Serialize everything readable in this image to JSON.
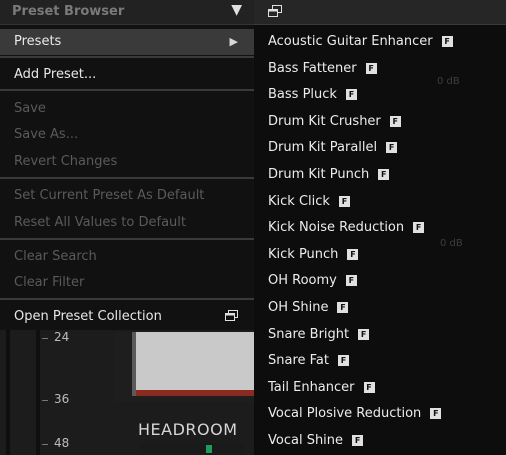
{
  "header": {
    "title": "Preset Browser",
    "dropdown_arrow": "▼"
  },
  "menu": {
    "presets": "Presets",
    "presets_arrow": "▶",
    "add_preset": "Add Preset...",
    "save": "Save",
    "save_as": "Save As...",
    "revert": "Revert Changes",
    "set_default": "Set Current Preset As Default",
    "reset_default": "Reset All Values to Default",
    "clear_search": "Clear Search",
    "clear_filter": "Clear Filter",
    "open_collection": "Open Preset Collection"
  },
  "presets": [
    {
      "label": "Acoustic Guitar Enhancer",
      "badge": "F"
    },
    {
      "label": "Bass Fattener",
      "badge": "F"
    },
    {
      "label": "Bass Pluck",
      "badge": "F"
    },
    {
      "label": "Drum Kit Crusher",
      "badge": "F"
    },
    {
      "label": "Drum Kit Parallel",
      "badge": "F"
    },
    {
      "label": "Drum Kit Punch",
      "badge": "F"
    },
    {
      "label": "Kick Click",
      "badge": "F"
    },
    {
      "label": "Kick Noise Reduction",
      "badge": "F"
    },
    {
      "label": "Kick Punch",
      "badge": "F"
    },
    {
      "label": "OH Roomy",
      "badge": "F"
    },
    {
      "label": "OH Shine",
      "badge": "F"
    },
    {
      "label": "Snare Bright",
      "badge": "F"
    },
    {
      "label": "Snare Fat",
      "badge": "F"
    },
    {
      "label": "Tail Enhancer",
      "badge": "F"
    },
    {
      "label": "Vocal Plosive Reduction",
      "badge": "F"
    },
    {
      "label": "Vocal Shine",
      "badge": "F"
    }
  ],
  "plugin": {
    "scale": [
      "24",
      "36",
      "48"
    ],
    "headroom_label": "HEADROOM"
  },
  "icons": {
    "collection": "window-stack-icon",
    "header": "window-stack-icon"
  }
}
